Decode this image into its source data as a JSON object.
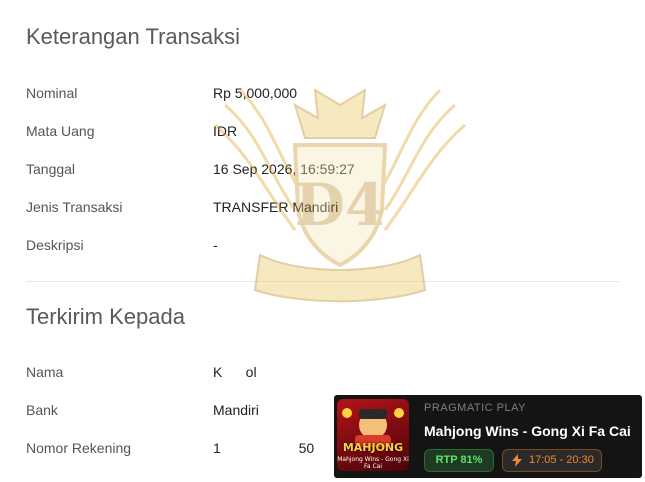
{
  "transaction": {
    "title": "Keterangan Transaksi",
    "rows": [
      {
        "label": "Nominal",
        "value": "Rp 5,000,000"
      },
      {
        "label": "Mata Uang",
        "value": "IDR"
      },
      {
        "label": "Tanggal",
        "value": "16 Sep 2026, 16:59:27"
      },
      {
        "label": "Jenis Transaksi",
        "value": "TRANSFER Mandiri"
      },
      {
        "label": "Deskripsi",
        "value": "-"
      }
    ]
  },
  "recipient": {
    "title": "Terkirim Kepada",
    "rows": [
      {
        "label": "Nama",
        "value": "K      ol"
      },
      {
        "label": "Bank",
        "value": "Mandiri"
      },
      {
        "label": "Nomor Rekening",
        "value": "1                    50"
      }
    ]
  },
  "watermark": {
    "icon": "winged-crown-emblem-icon",
    "color": "#d8a21f"
  },
  "game_card": {
    "provider": "PRAGMATIC PLAY",
    "title": "Mahjong Wins - Gong Xi Fa Cai",
    "thumbnail_title": "MAHJONG",
    "thumbnail_subtitle": "Mahjong Wins - Gong Xi Fa Cai",
    "rtp": "RTP 81%",
    "time_range": "17:05 - 20:30",
    "colors": {
      "background": "#141414",
      "rtp": "#5ee26a",
      "time": "#f08a2a"
    }
  }
}
